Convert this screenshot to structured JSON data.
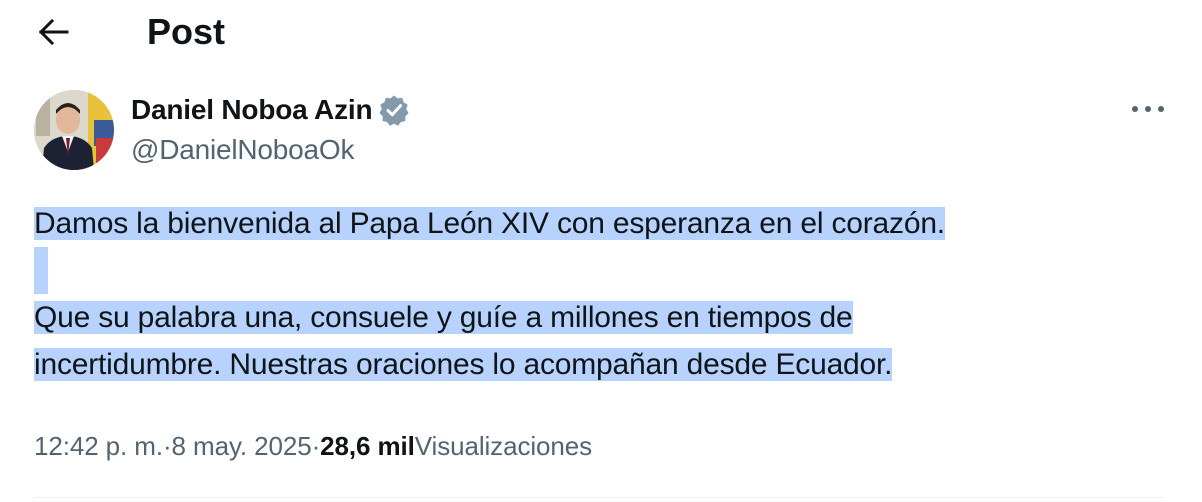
{
  "header": {
    "title": "Post",
    "back_icon": "arrow-left-icon"
  },
  "author": {
    "name": "Daniel Noboa Azin",
    "handle": "@DanielNoboaOk",
    "verified_icon": "verified-badge-icon",
    "verified_color": "#829aab"
  },
  "more_icon": "more-horizontal-icon",
  "tweet": {
    "line_1": "Damos la bienvenida al Papa León XIV con esperanza en el corazón.",
    "line_2": "Que su palabra una, consuele y guíe a millones en tiempos de",
    "line_3": "incertidumbre. Nuestras oraciones lo acompañan desde Ecuador.",
    "selection_color": "#b7d2fd"
  },
  "meta": {
    "time": "12:42 p. m.",
    "date": "8 may. 2025",
    "separator": "·",
    "views_count": "28,6 mil",
    "views_label": "Visualizaciones"
  },
  "colors": {
    "text_primary": "#0f1419",
    "text_secondary": "#536471"
  }
}
